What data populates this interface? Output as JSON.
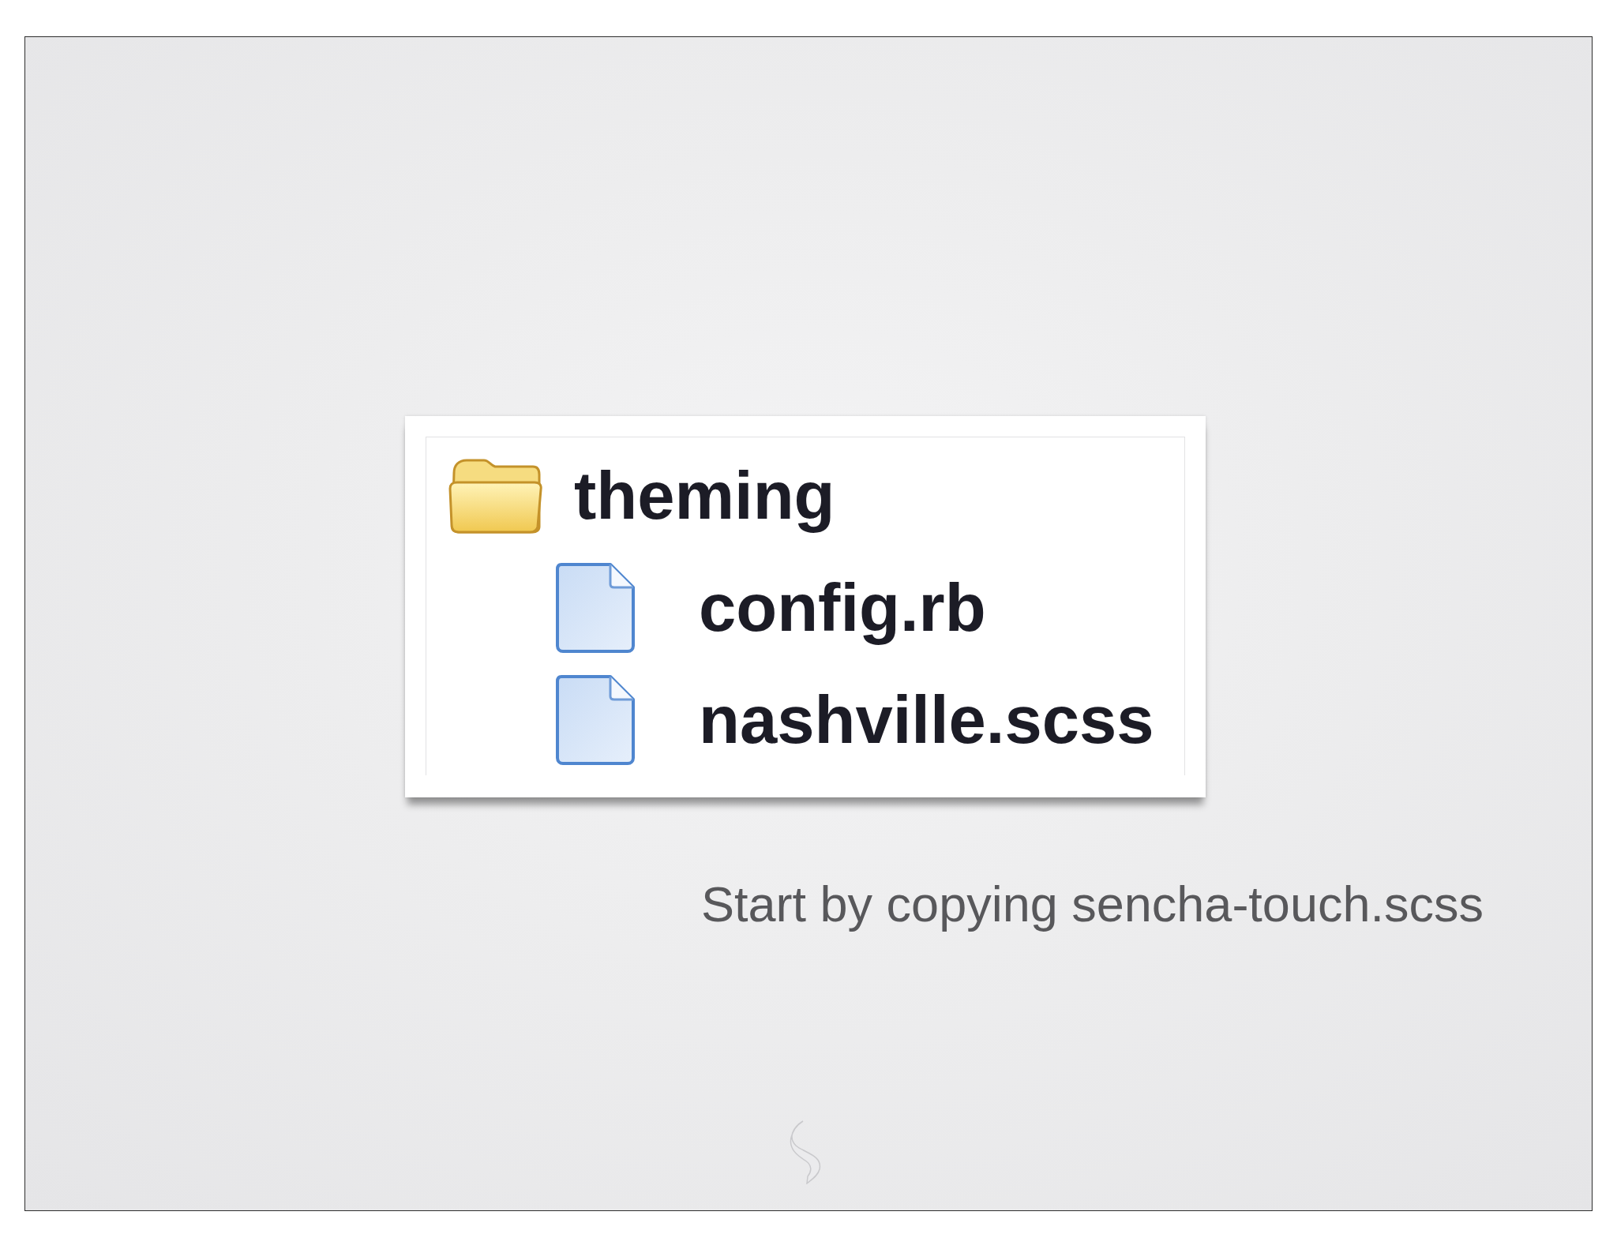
{
  "file_tree": {
    "items": [
      {
        "name": "theming",
        "kind": "folder",
        "expanded": true,
        "children": [
          {
            "name": "config.rb",
            "kind": "file"
          },
          {
            "name": "nashville.scss",
            "kind": "file"
          }
        ]
      }
    ]
  },
  "caption": "Start by copying sencha-touch.scss"
}
